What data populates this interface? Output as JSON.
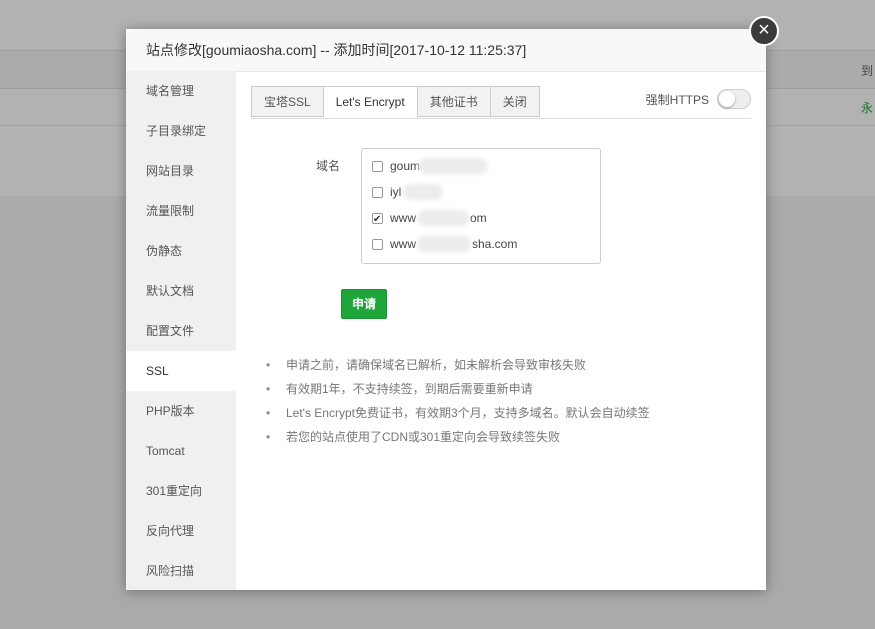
{
  "background": {
    "col_head": "到",
    "col_val": "永"
  },
  "modal": {
    "title": "站点修改[goumiaosha.com] -- 添加时间[2017-10-12 11:25:37]",
    "close_symbol": "×"
  },
  "sidebar": {
    "items": [
      {
        "label": "域名管理",
        "active": false
      },
      {
        "label": "子目录绑定",
        "active": false
      },
      {
        "label": "网站目录",
        "active": false
      },
      {
        "label": "流量限制",
        "active": false
      },
      {
        "label": "伪静态",
        "active": false
      },
      {
        "label": "默认文档",
        "active": false
      },
      {
        "label": "配置文件",
        "active": false
      },
      {
        "label": "SSL",
        "active": true
      },
      {
        "label": "PHP版本",
        "active": false
      },
      {
        "label": "Tomcat",
        "active": false
      },
      {
        "label": "301重定向",
        "active": false
      },
      {
        "label": "反向代理",
        "active": false
      },
      {
        "label": "风险扫描",
        "active": false
      }
    ]
  },
  "tabs": [
    {
      "label": "宝塔SSL",
      "active": false
    },
    {
      "label": "Let's Encrypt",
      "active": true
    },
    {
      "label": "其他证书",
      "active": false
    },
    {
      "label": "关闭",
      "active": false
    }
  ],
  "https_toggle": {
    "label": "强制HTTPS",
    "on": false
  },
  "domain_section": {
    "label": "域名",
    "domains": [
      {
        "prefix": "goum",
        "suffix": "",
        "checked": false
      },
      {
        "prefix": "iyl",
        "suffix": "",
        "checked": false
      },
      {
        "prefix": "www",
        "suffix": "om",
        "checked": true
      },
      {
        "prefix": "www",
        "suffix": "sha.com",
        "checked": false
      }
    ]
  },
  "apply_button": "申请",
  "notes": [
    "申请之前，请确保域名已解析，如未解析会导致审核失败",
    "有效期1年，不支持续签，到期后需要重新申请",
    "Let's Encrypt免费证书，有效期3个月，支持多域名。默认会自动续签",
    "若您的站点使用了CDN或301重定向会导致续签失败"
  ],
  "colors": {
    "accent_green": "#20a53a"
  }
}
